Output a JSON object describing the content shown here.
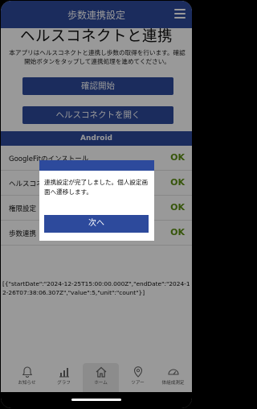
{
  "appbar": {
    "title": "歩数連携設定",
    "menu_icon": "hamburger-menu-icon"
  },
  "hero_title": "ヘルスコネクトと連携",
  "description": "本アプリはヘルスコネクトと連携し歩数の取得を行います。確認開始ボタンをタップして連携処理を進めてください。",
  "buttons": {
    "confirm_start": "確認開始",
    "open_health_connect": "ヘルスコネクトを開く"
  },
  "section_title": "Android",
  "status_rows": [
    {
      "label": "GoogleFitのインストール",
      "status": "OK"
    },
    {
      "label": "ヘルスコネクトのインストール",
      "status": "OK"
    },
    {
      "label": "権限設定",
      "status": "OK"
    },
    {
      "label": "歩数連携",
      "status": "OK"
    }
  ],
  "json_output": "[{\"startDate\":\"2024-12-25T15:00:00.000Z\",\"endDate\":\"2024-12-26T07:38:06.307Z\",\"value\":5,\"unit\":\"count\"}]",
  "dialog": {
    "message": "連携設定が完了しました。個人設定画面へ遷移します。",
    "next_button": "次へ"
  },
  "tabbar": {
    "items": [
      {
        "label": "お知らせ",
        "icon": "bell-icon"
      },
      {
        "label": "グラフ",
        "icon": "bar-chart-icon"
      },
      {
        "label": "ホーム",
        "icon": "home-icon"
      },
      {
        "label": "ツアー",
        "icon": "map-pin-icon"
      },
      {
        "label": "体組成測定",
        "icon": "gauge-icon"
      }
    ],
    "active_index": 2
  },
  "colors": {
    "primary": "#2d4a9c",
    "ok": "#5a8e12"
  }
}
